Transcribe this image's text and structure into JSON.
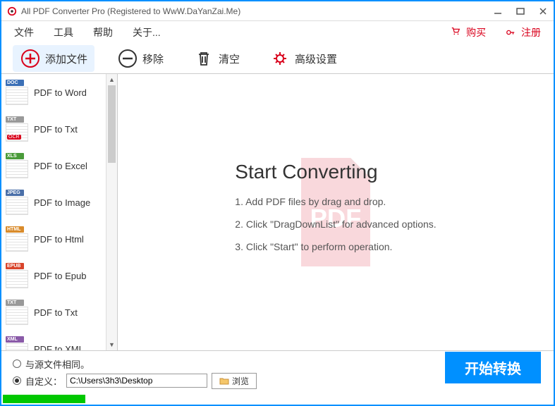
{
  "title": "All PDF Converter Pro (Registered to WwW.DaYanZai.Me)",
  "menu": {
    "file": "文件",
    "tools": "工具",
    "help": "帮助",
    "about": "关于...",
    "buy": "购买",
    "register": "注册"
  },
  "toolbar": {
    "add": "添加文件",
    "remove": "移除",
    "clear": "清空",
    "settings": "高级设置"
  },
  "formats": [
    {
      "badge": "DOC",
      "color": "#3b6fb6",
      "label": "PDF to Word",
      "ocr": false
    },
    {
      "badge": "TXT",
      "color": "#999999",
      "label": "PDF to Txt",
      "ocr": true
    },
    {
      "badge": "XLS",
      "color": "#4a9b3a",
      "label": "PDF to Excel",
      "ocr": false
    },
    {
      "badge": "JPEG",
      "color": "#4a6fa8",
      "label": "PDF to Image",
      "ocr": false
    },
    {
      "badge": "HTML",
      "color": "#d98b2b",
      "label": "PDF to Html",
      "ocr": false
    },
    {
      "badge": "EPUB",
      "color": "#d9442b",
      "label": "PDF to Epub",
      "ocr": false
    },
    {
      "badge": "TXT",
      "color": "#999999",
      "label": "PDF to Txt",
      "ocr": false
    },
    {
      "badge": "XML",
      "color": "#8a5aa8",
      "label": "PDF to XML",
      "ocr": false
    }
  ],
  "main": {
    "heading": "Start Converting",
    "step1": "1. Add PDF files by drag and drop.",
    "step2": "2. Click \"DragDownList\" for advanced options.",
    "step3": "3. Click \"Start\" to perform operation."
  },
  "footer": {
    "sameAsSource": "与源文件相同。",
    "custom": "自定义：",
    "path": "C:\\Users\\3h3\\Desktop",
    "browse": "浏览"
  },
  "convert": "开始转换",
  "ocrLabel": "OCR"
}
